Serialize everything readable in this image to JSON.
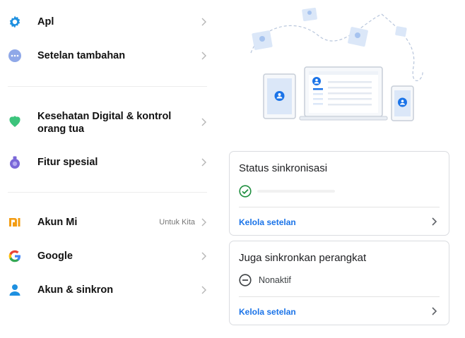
{
  "settings": {
    "items": [
      {
        "label": "Apl",
        "icon": "gear-icon"
      },
      {
        "label": "Setelan tambahan",
        "icon": "more-dots-icon"
      },
      {
        "label": "Kesehatan Digital & kontrol orang tua",
        "icon": "digital-wellbeing-icon"
      },
      {
        "label": "Fitur spesial",
        "icon": "special-features-icon"
      },
      {
        "label": "Akun Mi",
        "icon": "mi-logo-icon",
        "value": "Untuk Kita"
      },
      {
        "label": "Google",
        "icon": "google-icon"
      },
      {
        "label": "Akun & sinkron",
        "icon": "account-icon"
      }
    ]
  },
  "sync_status": {
    "title": "Status sinkronisasi",
    "link": "Kelola setelan",
    "status_icon": "check-circle-icon"
  },
  "device_sync": {
    "title": "Juga sinkronkan perangkat",
    "status": "Nonaktif",
    "status_icon": "minus-circle-icon",
    "link": "Kelola setelan"
  },
  "colors": {
    "accent": "#1a73e8",
    "success": "#1e8e3e",
    "illustration": "#c6dbf7",
    "avatar": "#1a73e8"
  }
}
